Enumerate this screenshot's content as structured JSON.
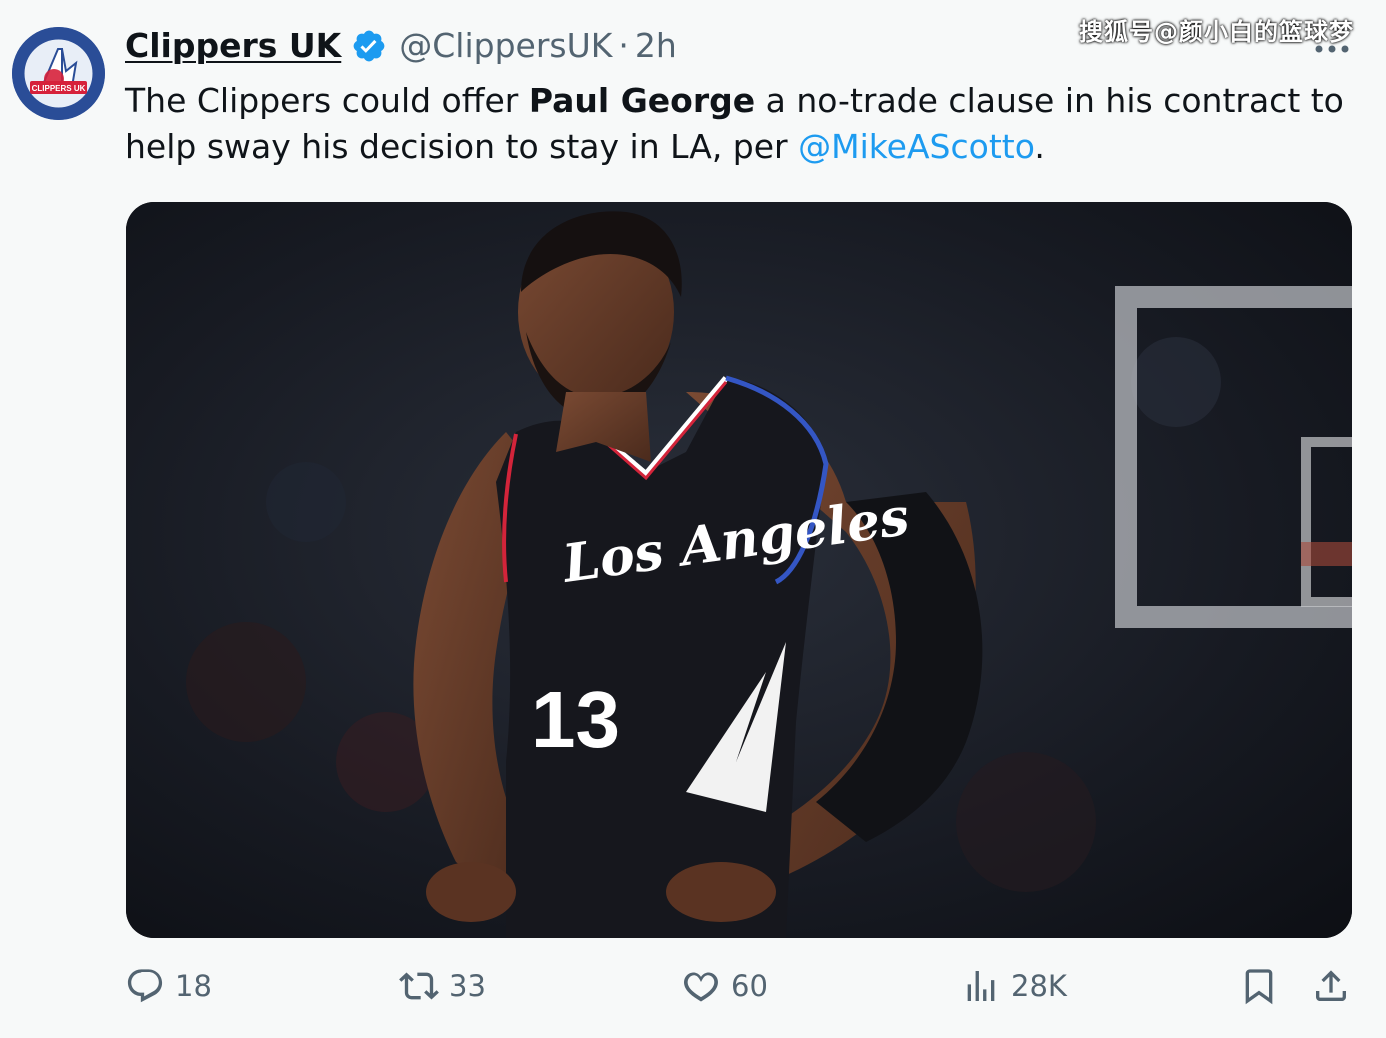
{
  "watermark": "搜狐号@颜小白的篮球梦",
  "author": {
    "display_name": "Clippers UK",
    "handle": "@ClippersUK",
    "separator": "·",
    "time": "2h",
    "avatar_icon": "clippers-logo-icon",
    "verified_icon": "verified-badge-icon"
  },
  "tweet": {
    "text_part1": "The Clippers could offer ",
    "text_bold": "Paul George",
    "text_part2": " a no-trade clause in his contract to help sway his decision to stay in LA, per ",
    "mention": "@MikeAScotto",
    "text_end": "."
  },
  "media": {
    "jersey_city": "Los Angeles",
    "jersey_number": "13"
  },
  "actions": {
    "reply_count": "18",
    "retweet_count": "33",
    "like_count": "60",
    "views_count": "28K"
  },
  "colors": {
    "accent": "#1d9bf0",
    "text_primary": "#0f1419",
    "text_secondary": "#536471",
    "background": "#f7f9f9"
  }
}
